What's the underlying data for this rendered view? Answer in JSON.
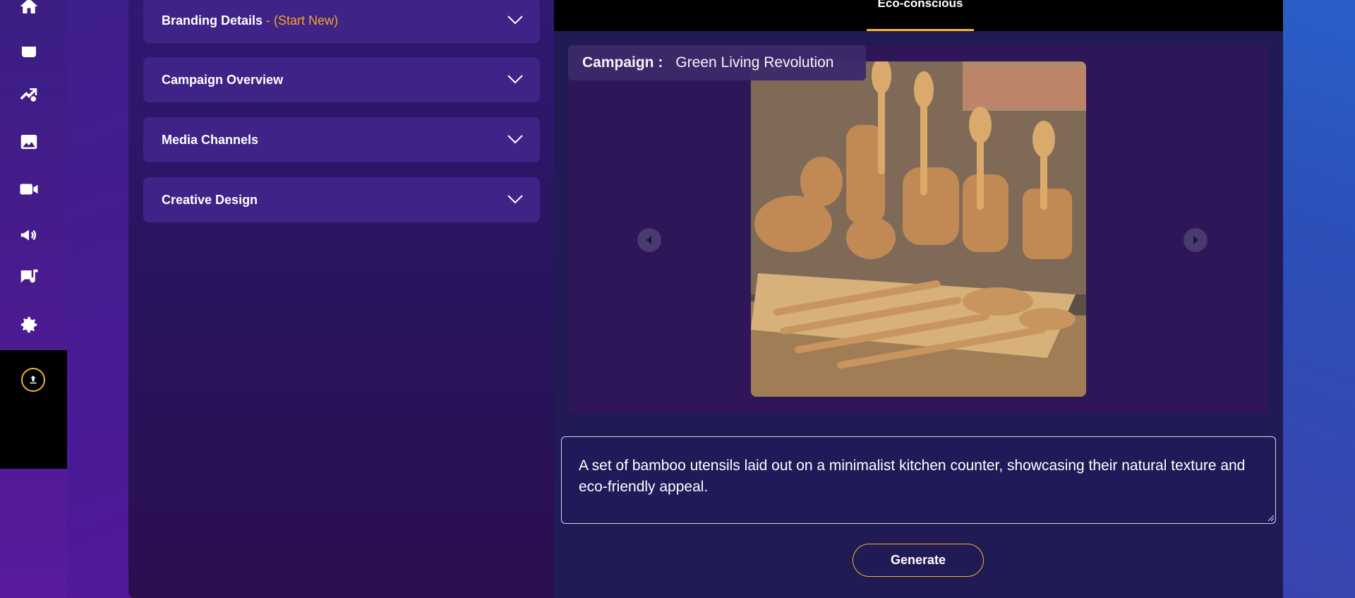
{
  "sidebar": {
    "icons": [
      "home-icon",
      "calendar-icon",
      "campaign-icon",
      "image-icon",
      "video-icon",
      "megaphone-icon",
      "music-note-icon",
      "settings-icon"
    ],
    "upload_icon": "upload-icon"
  },
  "accordion": [
    {
      "title": "Branding Details",
      "subtitle": " - (Start New)"
    },
    {
      "title": "Campaign Overview",
      "subtitle": ""
    },
    {
      "title": "Media Channels",
      "subtitle": ""
    },
    {
      "title": "Creative Design",
      "subtitle": ""
    }
  ],
  "tabs": {
    "active_label": "Eco-conscious"
  },
  "preview": {
    "campaign_key": "Campaign :",
    "campaign_value": "Green Living Revolution",
    "prev_icon": "chevron-left-icon",
    "next_icon": "chevron-right-icon"
  },
  "prompt": {
    "value": "A set of bamboo utensils laid out on a minimalist kitchen counter, showcasing their natural texture and eco-friendly appeal."
  },
  "actions": {
    "generate_label": "Generate"
  },
  "colors": {
    "accent": "#f5b52c",
    "subtitle": "#f5a623",
    "panel": "#3f2387"
  }
}
